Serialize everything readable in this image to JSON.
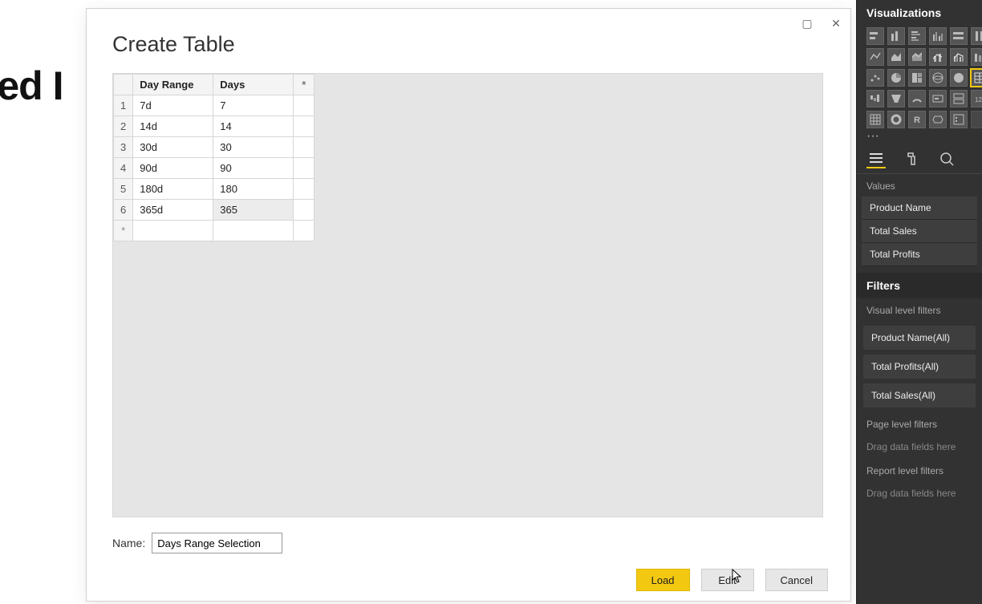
{
  "background_text": "aded I",
  "dialog": {
    "title": "Create Table",
    "headers": {
      "col1": "Day Range",
      "col2": "Days",
      "star": "*"
    },
    "rows": [
      {
        "n": "1",
        "day_range": "7d",
        "days": "7"
      },
      {
        "n": "2",
        "day_range": "14d",
        "days": "14"
      },
      {
        "n": "3",
        "day_range": "30d",
        "days": "30"
      },
      {
        "n": "4",
        "day_range": "90d",
        "days": "90"
      },
      {
        "n": "5",
        "day_range": "180d",
        "days": "180"
      },
      {
        "n": "6",
        "day_range": "365d",
        "days": "365"
      }
    ],
    "new_row_marker": "*",
    "name_label": "Name:",
    "name_value": "Days Range Selection",
    "buttons": {
      "load": "Load",
      "edit": "Edit",
      "cancel": "Cancel"
    }
  },
  "visualizations": {
    "title": "Visualizations",
    "ellipsis": "···",
    "values_label": "Values",
    "values": [
      "Product Name",
      "Total Sales",
      "Total Profits"
    ],
    "filters_label": "Filters",
    "visual_level_label": "Visual level filters",
    "visual_filters": [
      "Product Name(All)",
      "Total Profits(All)",
      "Total Sales(All)"
    ],
    "page_level_label": "Page level filters",
    "page_drop_hint": "Drag data fields here",
    "report_level_label": "Report level filters",
    "report_drop_hint": "Drag data fields here"
  }
}
